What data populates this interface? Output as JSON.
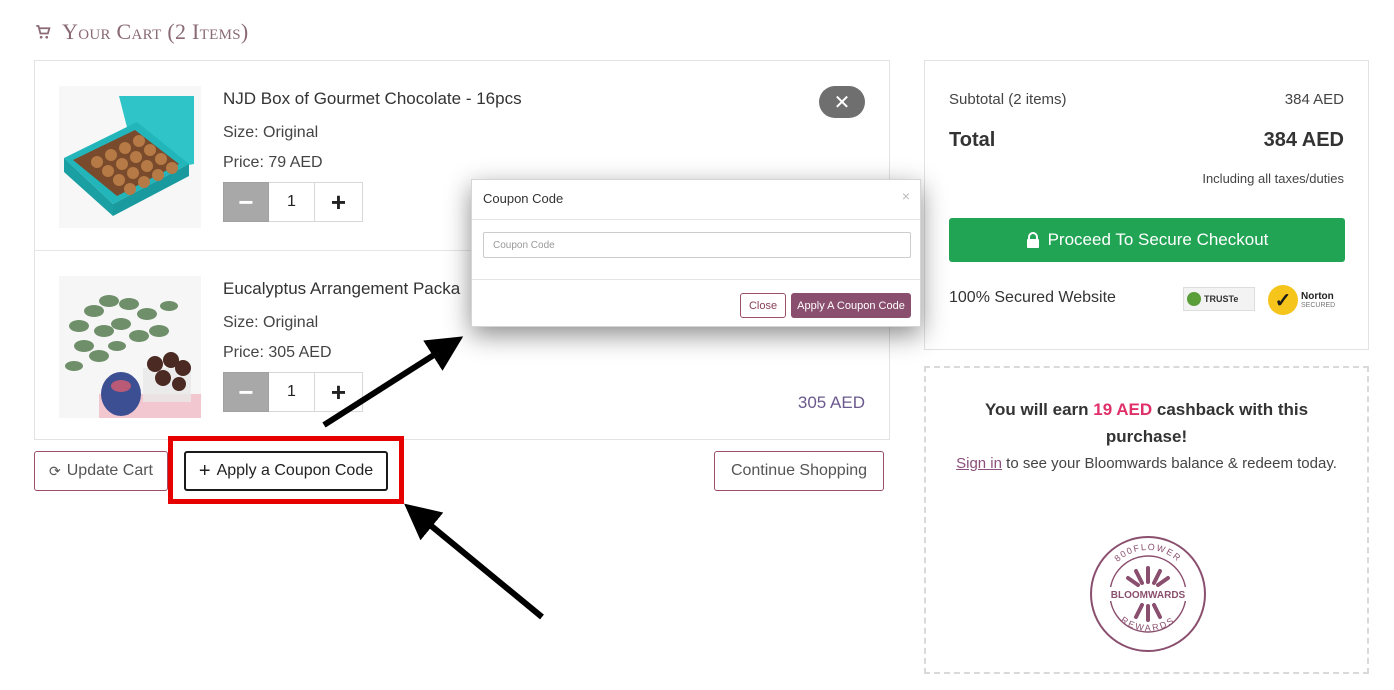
{
  "header": {
    "title": "Your Cart (2 Items)",
    "icon": "cart-icon"
  },
  "items": [
    {
      "name": "NJD Box of Gourmet Chocolate - 16pcs",
      "size": "Size: Original",
      "price": "Price: 79 AED",
      "quantity": "1",
      "minus": "−",
      "plus": "+",
      "remove": "✕",
      "total": ""
    },
    {
      "name": "Eucalyptus Arrangement Packa",
      "size": "Size: Original",
      "price": "Price: 305 AED",
      "quantity": "1",
      "minus": "−",
      "plus": "+",
      "total": "305 AED"
    }
  ],
  "actions": {
    "update_cart": "Update Cart",
    "update_icon": "⟳",
    "apply_coupon": "Apply a Coupon Code",
    "apply_icon": "+",
    "continue_shopping": "Continue Shopping"
  },
  "summary": {
    "subtotal_label": "Subtotal (2 items)",
    "subtotal_value": "384 AED",
    "total_label": "Total",
    "total_value": "384 AED",
    "tax_note": "Including all taxes/duties",
    "checkout_label": "Proceed To Secure Checkout",
    "secured_text": "100% Secured Website",
    "trust_badge": "TRUSTe",
    "norton_badge": "Norton",
    "norton_sub": "SECURED"
  },
  "rewards": {
    "earn_prefix": "You will earn ",
    "earn_amount": "19 AED",
    "earn_suffix": " cashback with this purchase!",
    "signin_link": "Sign in",
    "signin_suffix": " to see your Bloomwards balance & redeem today.",
    "logo_top": "800FLOWER",
    "logo_middle": "BLOOMWARDS",
    "logo_bottom": "REWARDS"
  },
  "modal": {
    "title": "Coupon Code",
    "close_icon": "×",
    "input_placeholder": "Coupon Code",
    "close_button": "Close",
    "apply_button": "Apply A Coupon Code"
  },
  "colors": {
    "accent": "#9c4f67",
    "checkout": "#22a455",
    "highlight": "#e60000",
    "cashback": "#e0306a"
  }
}
